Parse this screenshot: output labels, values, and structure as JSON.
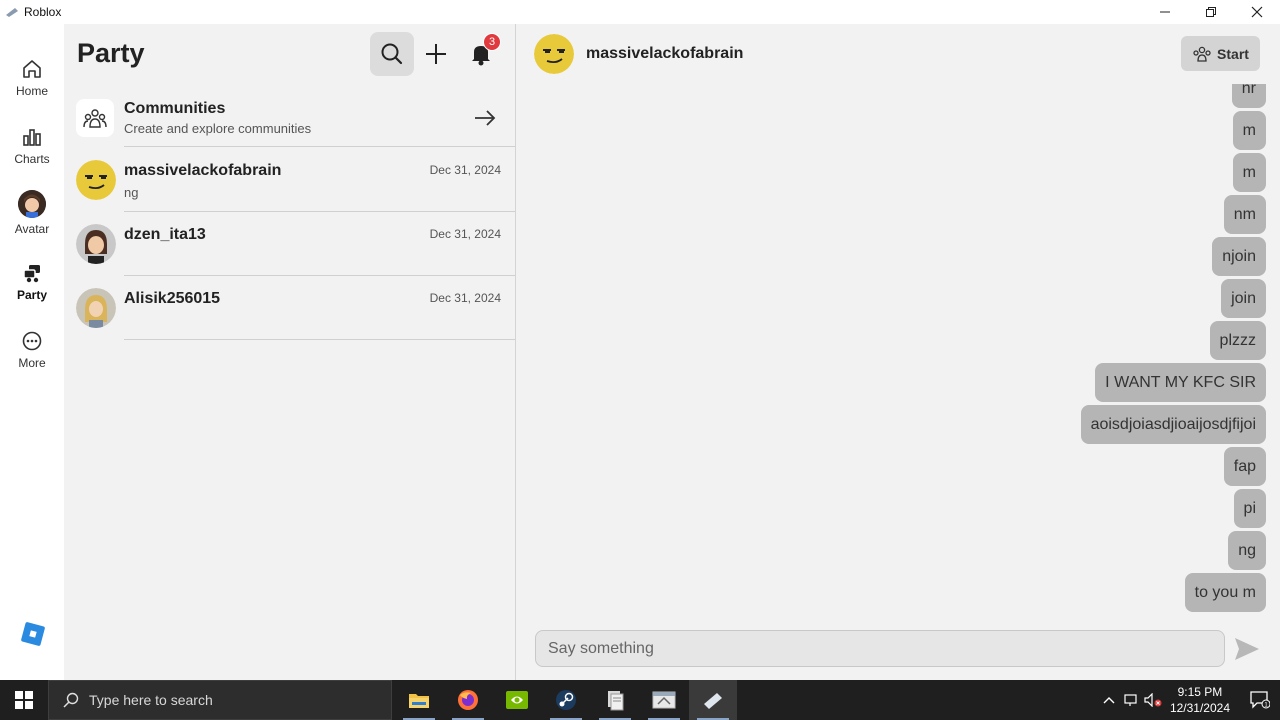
{
  "window": {
    "title": "Roblox"
  },
  "nav": {
    "items": [
      {
        "label": "Home",
        "icon": "home-icon"
      },
      {
        "label": "Charts",
        "icon": "charts-icon"
      },
      {
        "label": "Avatar",
        "icon": "avatar-icon"
      },
      {
        "label": "Party",
        "icon": "party-icon"
      },
      {
        "label": "More",
        "icon": "more-icon"
      }
    ],
    "active": "Party"
  },
  "party": {
    "title": "Party",
    "notification_count": "3",
    "communities": {
      "title": "Communities",
      "subtitle": "Create and explore communities"
    },
    "conversations": [
      {
        "name": "massivelackofabrain",
        "preview": "ng",
        "date": "Dec 31, 2024"
      },
      {
        "name": "dzen_ita13",
        "preview": "",
        "date": "Dec 31, 2024"
      },
      {
        "name": "Alisik256015",
        "preview": "",
        "date": "Dec 31, 2024"
      }
    ]
  },
  "chat": {
    "recipient": "massivelackofabrain",
    "start_label": "Start",
    "messages": [
      "nr",
      "m",
      "m",
      "nm",
      "njoin",
      "join",
      "plzzz",
      "I WANT MY KFC SIR",
      "aoisdjoiasdjioaijosdjfijoi",
      "fap",
      "pi",
      "ng",
      "to you m"
    ],
    "input_placeholder": "Say something"
  },
  "taskbar": {
    "search_placeholder": "Type here to search",
    "time": "9:15 PM",
    "date": "12/31/2024",
    "notification_count": "1"
  },
  "colors": {
    "accent": "#e0393e",
    "bubble": "#b5b5b5",
    "taskbar": "#1f1f1f"
  }
}
